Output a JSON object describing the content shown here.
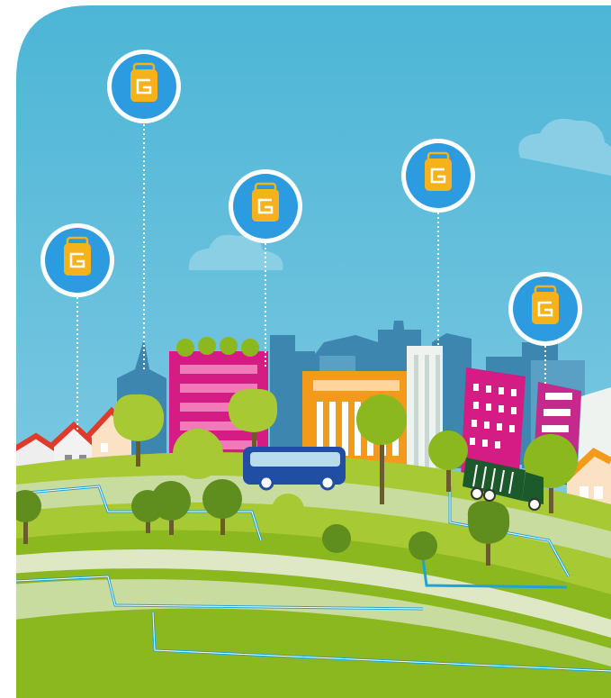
{
  "illustration": {
    "sky_color": "#4cb3d4",
    "ground_color": "#8cb81f",
    "path_color": "#c9dca0",
    "pipe_color": "#1ea3d8",
    "pin_ring": "#ffffff",
    "pin_fill": "#2d9be0",
    "sensor_color": "#f6b21b"
  },
  "sensor_pins": [
    {
      "icon": "sensor-bin-icon"
    },
    {
      "icon": "sensor-bin-icon"
    },
    {
      "icon": "sensor-bin-icon"
    },
    {
      "icon": "sensor-bin-icon"
    },
    {
      "icon": "sensor-bin-icon"
    }
  ]
}
